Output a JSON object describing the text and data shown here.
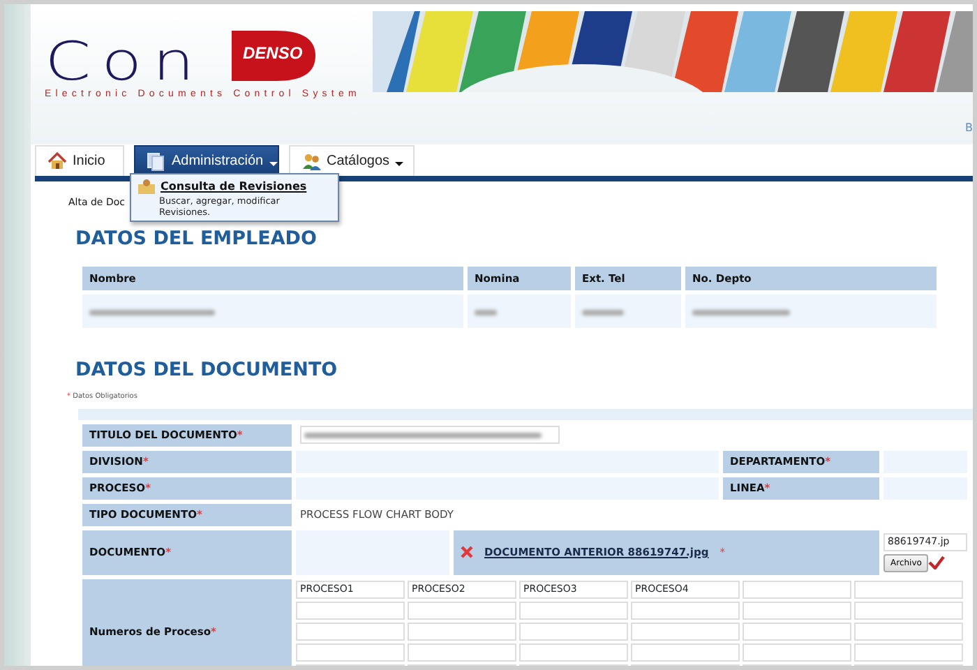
{
  "logo": {
    "name": "Con",
    "mark": "DENSO",
    "subtitle": "Electronic Documents Control System"
  },
  "header_link": "B",
  "tabs": [
    {
      "label": "Inicio",
      "selected": false,
      "dropdown": false
    },
    {
      "label": "Administración",
      "selected": true,
      "dropdown": true
    },
    {
      "label": "Catálogos",
      "selected": false,
      "dropdown": true
    }
  ],
  "dropdown_menu": {
    "items": [
      {
        "title": "Consulta de Revisiones",
        "description": "Buscar, agregar, modificar Revisiones."
      }
    ]
  },
  "breadcrumb": "Alta de Doc",
  "employee_section": {
    "heading": "DATOS DEL EMPLEADO",
    "columns": [
      "Nombre",
      "Nomina",
      "Ext. Tel",
      "No. Depto"
    ]
  },
  "document_section": {
    "heading": "DATOS DEL DOCUMENTO",
    "required_mark": "*",
    "required_note": "Datos Obligatorios",
    "rows": [
      {
        "kind": "input",
        "label": "TITULO DEL DOCUMENTO",
        "mark": "*"
      },
      {
        "kind": "pair",
        "label": "DIVISION",
        "mark": "*",
        "right_label": "DEPARTAMENTO",
        "right_mark": "*"
      },
      {
        "kind": "pair",
        "label": "PROCESO",
        "mark": "*",
        "right_label": "LINEA",
        "right_mark": "*"
      },
      {
        "kind": "text",
        "label": "TIPO DOCUMENTO",
        "mark": "*",
        "value": "PROCESS FLOW CHART BODY"
      },
      {
        "kind": "file",
        "label": "DOCUMENTO",
        "mark": "*",
        "link": "DOCUMENTO ANTERIOR 88619747.jpg",
        "link_mark": "*",
        "file_value": "88619747.jp",
        "button": "Archivo"
      },
      {
        "kind": "grid",
        "label": "Numeros de Proceso",
        "mark": "*",
        "first_row": [
          "PROCESO1",
          "PROCESO2",
          "PROCESO3",
          "PROCESO4"
        ]
      }
    ]
  }
}
